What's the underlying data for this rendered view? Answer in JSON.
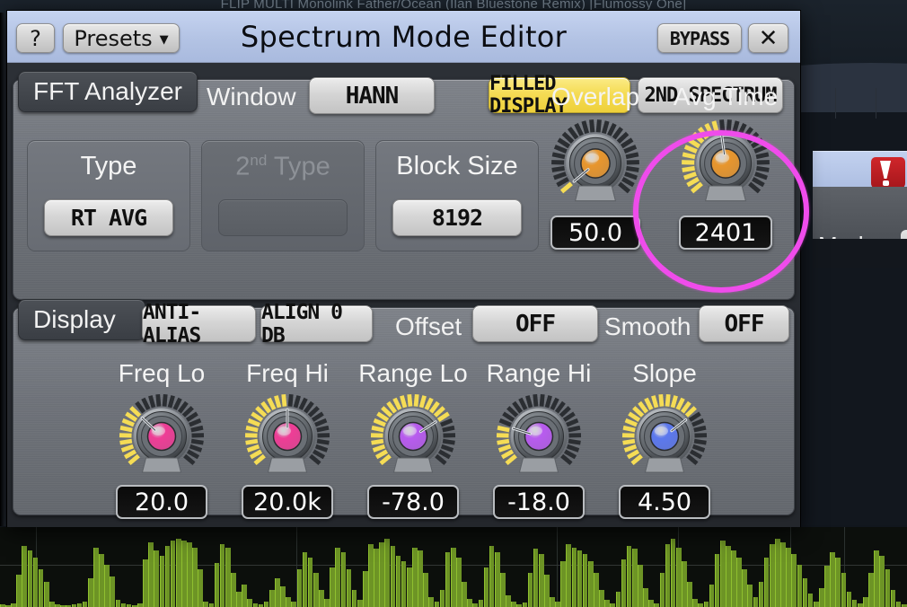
{
  "background": {
    "host_text": "FLIP MULTI      Monolink      Father/Ocean (Ilan Bluestone Remix) [Flumossy One]",
    "plugin_mode_label": "Mode",
    "logo_icon": "waves-logo-icon"
  },
  "window": {
    "title": "Spectrum Mode Editor",
    "help_label": "?",
    "presets_label": "Presets",
    "presets_caret": "▼",
    "bypass_label": "BYPASS",
    "close_label": "✕"
  },
  "fft": {
    "tab_label": "FFT Analyzer",
    "window_label": "Window",
    "window_value": "HANN",
    "filled_display_label": "FILLED DISPLAY",
    "second_spectrum_label": "2ND SPECTRUM",
    "type_label": "Type",
    "type_value": "RT AVG",
    "second_type_label_pre": "2",
    "second_type_label_sup": "nd",
    "second_type_label_post": " Type",
    "second_type_value": "",
    "block_size_label": "Block Size",
    "block_size_value": "8192",
    "overlap_label": "Overlap",
    "overlap_value": "50.0",
    "avg_time_label": "Avg Time",
    "avg_time_value": "2401"
  },
  "display": {
    "tab_label": "Display",
    "anti_alias_label": "ANTI-ALIAS",
    "align_0db_label": "ALIGN 0 DB",
    "offset_label": "Offset",
    "offset_value": "OFF",
    "smooth_label": "Smooth",
    "smooth_value": "OFF",
    "knobs": [
      {
        "label": "Freq Lo",
        "value": "20.0",
        "color": "#ef3d96",
        "fill": 0.32
      },
      {
        "label": "Freq Hi",
        "value": "20.0k",
        "color": "#ef3d96",
        "fill": 0.5
      },
      {
        "label": "Range Lo",
        "value": "-78.0",
        "color": "#b85bef",
        "fill": 0.72
      },
      {
        "label": "Range Hi",
        "value": "-18.0",
        "color": "#b85bef",
        "fill": 0.22
      },
      {
        "label": "Slope",
        "value": "4.50",
        "color": "#5c78ee",
        "fill": 0.7
      }
    ]
  },
  "colors": {
    "titlebar": "#b3c3e4",
    "accent_yellow": "#f5dc55",
    "highlight_ring": "#ef4ceb",
    "knob_orange": "#e8962d",
    "spectrum_green": "#6d9425",
    "panel_gray": "#6e7279"
  },
  "highlight": {
    "target": "avg-time-knob",
    "shape": "circle",
    "color": "#ef4ceb"
  },
  "spectrum": {
    "type": "bar",
    "bars": [
      3,
      2,
      4,
      38,
      72,
      66,
      58,
      44,
      30,
      6,
      3,
      2,
      2,
      3,
      4,
      6,
      34,
      70,
      62,
      50,
      36,
      8,
      4,
      3,
      2,
      4,
      56,
      76,
      66,
      60,
      72,
      78,
      80,
      78,
      76,
      70,
      44,
      6,
      4,
      52,
      74,
      70,
      40,
      18,
      26,
      10,
      4,
      3,
      6,
      20,
      34,
      24,
      12,
      6,
      44,
      64,
      58,
      40,
      20,
      10,
      46,
      70,
      64,
      44,
      20,
      8,
      42,
      74,
      68,
      76,
      80,
      72,
      60,
      54,
      46,
      70,
      66,
      40,
      12,
      6,
      20,
      64,
      70,
      58,
      30,
      10,
      4,
      8,
      46,
      72,
      64,
      40,
      14,
      6,
      3,
      5,
      40,
      68,
      62,
      38,
      12,
      6,
      54,
      74,
      70,
      66,
      62,
      54,
      40,
      20,
      8,
      4,
      18,
      56,
      72,
      68,
      50,
      22,
      8,
      4,
      40,
      74,
      80,
      70,
      54,
      30,
      10,
      4,
      6,
      26,
      62,
      78,
      72,
      66,
      58,
      44,
      26,
      12,
      30,
      58,
      74,
      80,
      76,
      70,
      62,
      50,
      34,
      16,
      6,
      22,
      48,
      64,
      58,
      40,
      18,
      8,
      4,
      12,
      40,
      66,
      60,
      44,
      20,
      6,
      3
    ]
  }
}
